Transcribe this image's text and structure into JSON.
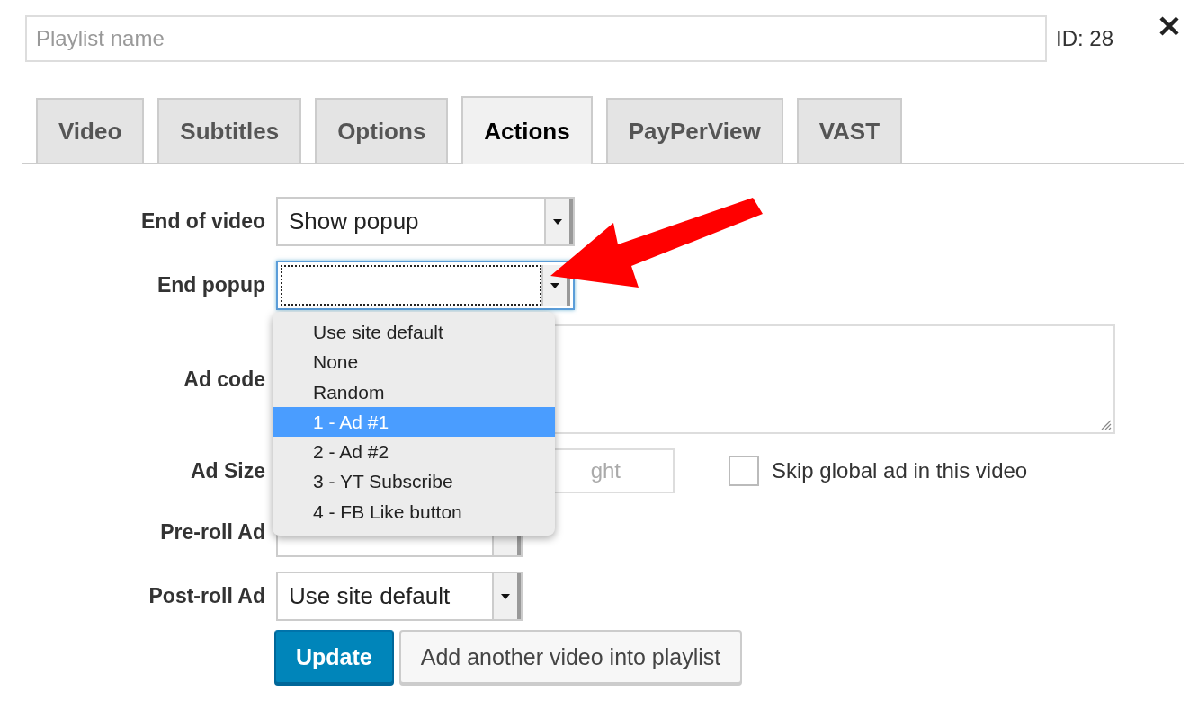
{
  "playlist": {
    "placeholder": "Playlist name",
    "id_label": "ID: 28"
  },
  "tabs": [
    {
      "label": "Video",
      "selected": false
    },
    {
      "label": "Subtitles",
      "selected": false
    },
    {
      "label": "Options",
      "selected": false
    },
    {
      "label": "Actions",
      "selected": true
    },
    {
      "label": "PayPerView",
      "selected": false
    },
    {
      "label": "VAST",
      "selected": false
    }
  ],
  "fields": [
    {
      "kind": "select",
      "label": "End of video",
      "value": "Show popup",
      "focused": false
    },
    {
      "kind": "select",
      "label": "End popup",
      "focused": true
    },
    {
      "kind": "textarea",
      "label": "Ad code"
    },
    {
      "kind": "size",
      "label": "Ad Size",
      "height_placeholder": "ght",
      "checkbox": {
        "label": "Skip global ad in this video",
        "checked": false
      }
    },
    {
      "kind": "select",
      "label": "Pre-roll Ad",
      "focused": false
    },
    {
      "kind": "select",
      "label": "Post-roll Ad",
      "value": "Use site default",
      "focused": false
    }
  ],
  "dropdown": {
    "options": [
      {
        "label": "Use site default",
        "selected": false
      },
      {
        "label": "None",
        "selected": false
      },
      {
        "label": "Random",
        "selected": false
      },
      {
        "label": "1 - Ad #1",
        "selected": true
      },
      {
        "label": "2 - Ad #2",
        "selected": false
      },
      {
        "label": "3 - YT Subscribe",
        "selected": false
      },
      {
        "label": "4 - FB Like button",
        "selected": false
      }
    ]
  },
  "buttons": [
    {
      "label": "Update",
      "kind": "primary"
    },
    {
      "label": "Add another video into playlist",
      "kind": "secondary"
    }
  ]
}
